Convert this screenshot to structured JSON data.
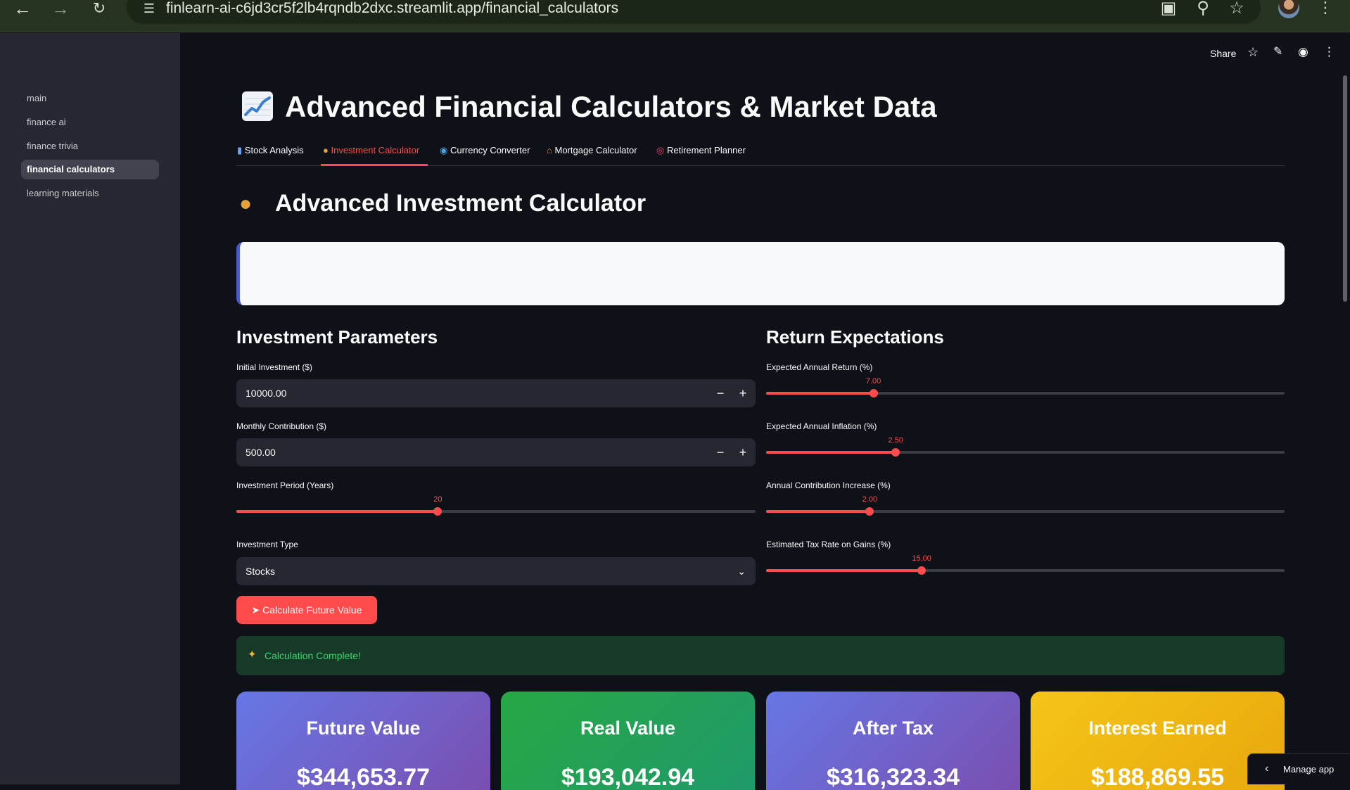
{
  "browser": {
    "url": "finlearn-ai-c6jd3cr5f2lb4rqndb2dxc.streamlit.app/financial_calculators"
  },
  "sidebar": {
    "items": [
      {
        "label": "main"
      },
      {
        "label": "finance ai"
      },
      {
        "label": "finance trivia"
      },
      {
        "label": "financial calculators"
      },
      {
        "label": "learning materials"
      }
    ],
    "active_item": "financial calculators"
  },
  "toolbar": {
    "share_label": "Share"
  },
  "page": {
    "title": "Advanced Financial Calculators & Market Data",
    "title_icon": "chart-increasing-icon"
  },
  "tabs": [
    {
      "label": "Stock Analysis",
      "icon": "bar-chart-icon"
    },
    {
      "label": "Investment Calculator",
      "icon": "money-bag-icon"
    },
    {
      "label": "Currency Converter",
      "icon": "globe-icon"
    },
    {
      "label": "Mortgage Calculator",
      "icon": "house-icon"
    },
    {
      "label": "Retirement Planner",
      "icon": "target-icon"
    }
  ],
  "active_tab": "Investment Calculator",
  "section": {
    "heading": "Advanced Investment Calculator",
    "icon": "money-bag-icon"
  },
  "investment_parameters": {
    "heading": "Investment Parameters",
    "initial_investment": {
      "label": "Initial Investment ($)",
      "value": "10000.00"
    },
    "monthly_contribution": {
      "label": "Monthly Contribution ($)",
      "value": "500.00"
    },
    "investment_period": {
      "label": "Investment Period (Years)",
      "value": "20",
      "fraction": 0.388
    },
    "investment_type": {
      "label": "Investment Type",
      "value": "Stocks"
    }
  },
  "return_expectations": {
    "heading": "Return Expectations",
    "annual_return": {
      "label": "Expected Annual Return (%)",
      "value": "7.00",
      "fraction": 0.207
    },
    "annual_inflation": {
      "label": "Expected Annual Inflation (%)",
      "value": "2.50",
      "fraction": 0.25
    },
    "contribution_increase": {
      "label": "Annual Contribution Increase (%)",
      "value": "2.00",
      "fraction": 0.2
    },
    "tax_rate": {
      "label": "Estimated Tax Rate on Gains (%)",
      "value": "15.00",
      "fraction": 0.3
    }
  },
  "calculate_button": {
    "label": "Calculate Future Value"
  },
  "success_message": "Calculation Complete!",
  "results": [
    {
      "title": "Future Value",
      "value": "$344,653.77"
    },
    {
      "title": "Real Value",
      "value": "$193,042.94"
    },
    {
      "title": "After Tax",
      "value": "$316,323.34"
    },
    {
      "title": "Interest Earned",
      "value": "$188,869.55"
    }
  ],
  "manage_app": {
    "label": "Manage app"
  },
  "colors": {
    "accent": "#ff4b4b",
    "background": "#0e1117",
    "sidebar": "#262730",
    "success": "#3dd56d"
  }
}
